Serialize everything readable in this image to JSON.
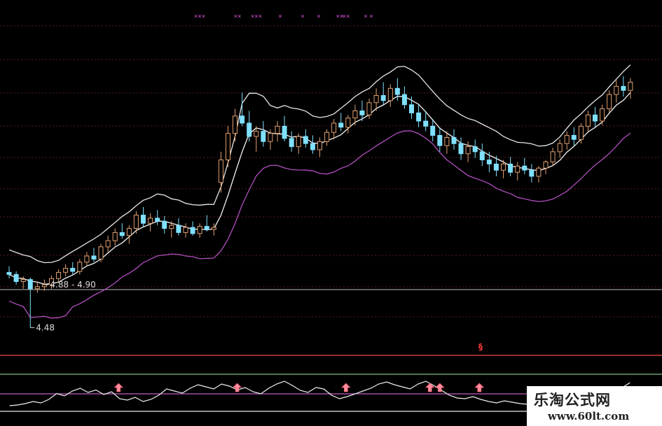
{
  "chart_data": [
    {
      "type": "candlestick",
      "title": "",
      "price_labels": [
        {
          "text": "4.88 - 4.90",
          "index": 5
        },
        {
          "text": "4.48",
          "index": 3
        }
      ],
      "top_markers": [
        "×××",
        "××",
        "×××",
        "×",
        "×",
        "×",
        "××",
        "×",
        "××",
        "×"
      ],
      "candles": [
        [
          5.02,
          5.08,
          4.96,
          5.0
        ],
        [
          5.0,
          5.03,
          4.9,
          4.93
        ],
        [
          4.93,
          4.98,
          4.86,
          4.95
        ],
        [
          4.95,
          4.97,
          4.48,
          4.86
        ],
        [
          4.86,
          4.92,
          4.82,
          4.88
        ],
        [
          4.88,
          4.95,
          4.84,
          4.9
        ],
        [
          4.9,
          4.99,
          4.86,
          4.96
        ],
        [
          4.96,
          5.05,
          4.92,
          5.02
        ],
        [
          5.02,
          5.1,
          4.98,
          5.06
        ],
        [
          5.06,
          5.12,
          5.0,
          5.03
        ],
        [
          5.03,
          5.15,
          5.0,
          5.12
        ],
        [
          5.12,
          5.22,
          5.08,
          5.18
        ],
        [
          5.18,
          5.26,
          5.12,
          5.15
        ],
        [
          5.15,
          5.3,
          5.12,
          5.27
        ],
        [
          5.27,
          5.38,
          5.22,
          5.33
        ],
        [
          5.33,
          5.45,
          5.28,
          5.41
        ],
        [
          5.41,
          5.5,
          5.35,
          5.38
        ],
        [
          5.38,
          5.48,
          5.3,
          5.45
        ],
        [
          5.45,
          5.62,
          5.4,
          5.58
        ],
        [
          5.58,
          5.66,
          5.46,
          5.5
        ],
        [
          5.5,
          5.6,
          5.42,
          5.55
        ],
        [
          5.55,
          5.63,
          5.48,
          5.52
        ],
        [
          5.52,
          5.57,
          5.4,
          5.45
        ],
        [
          5.45,
          5.52,
          5.36,
          5.48
        ],
        [
          5.48,
          5.55,
          5.38,
          5.41
        ],
        [
          5.41,
          5.5,
          5.36,
          5.46
        ],
        [
          5.46,
          5.52,
          5.38,
          5.4
        ],
        [
          5.4,
          5.5,
          5.36,
          5.47
        ],
        [
          5.47,
          5.58,
          5.42,
          5.44
        ],
        [
          5.44,
          5.5,
          5.38,
          5.46
        ],
        [
          5.9,
          6.2,
          5.8,
          6.12
        ],
        [
          6.12,
          6.45,
          6.05,
          6.38
        ],
        [
          6.38,
          6.62,
          6.3,
          6.55
        ],
        [
          6.55,
          6.78,
          6.45,
          6.48
        ],
        [
          6.48,
          6.6,
          6.3,
          6.35
        ],
        [
          6.35,
          6.45,
          6.2,
          6.4
        ],
        [
          6.4,
          6.5,
          6.25,
          6.3
        ],
        [
          6.3,
          6.42,
          6.22,
          6.38
        ],
        [
          6.38,
          6.5,
          6.3,
          6.45
        ],
        [
          6.45,
          6.55,
          6.3,
          6.33
        ],
        [
          6.33,
          6.4,
          6.2,
          6.25
        ],
        [
          6.25,
          6.38,
          6.18,
          6.35
        ],
        [
          6.35,
          6.42,
          6.24,
          6.28
        ],
        [
          6.28,
          6.36,
          6.18,
          6.22
        ],
        [
          6.22,
          6.34,
          6.15,
          6.3
        ],
        [
          6.3,
          6.42,
          6.26,
          6.39
        ],
        [
          6.39,
          6.52,
          6.32,
          6.48
        ],
        [
          6.48,
          6.58,
          6.4,
          6.44
        ],
        [
          6.44,
          6.56,
          6.38,
          6.53
        ],
        [
          6.53,
          6.66,
          6.46,
          6.6
        ],
        [
          6.6,
          6.7,
          6.5,
          6.56
        ],
        [
          6.56,
          6.72,
          6.52,
          6.68
        ],
        [
          6.68,
          6.82,
          6.6,
          6.75
        ],
        [
          6.75,
          6.88,
          6.66,
          6.7
        ],
        [
          6.7,
          6.86,
          6.64,
          6.82
        ],
        [
          6.82,
          6.92,
          6.7,
          6.76
        ],
        [
          6.76,
          6.84,
          6.62,
          6.66
        ],
        [
          6.66,
          6.74,
          6.52,
          6.58
        ],
        [
          6.58,
          6.66,
          6.44,
          6.5
        ],
        [
          6.5,
          6.6,
          6.4,
          6.45
        ],
        [
          6.45,
          6.52,
          6.3,
          6.36
        ],
        [
          6.36,
          6.44,
          6.2,
          6.26
        ],
        [
          6.26,
          6.4,
          6.18,
          6.34
        ],
        [
          6.34,
          6.42,
          6.22,
          6.28
        ],
        [
          6.28,
          6.34,
          6.12,
          6.18
        ],
        [
          6.18,
          6.3,
          6.1,
          6.25
        ],
        [
          6.25,
          6.32,
          6.14,
          6.2
        ],
        [
          6.2,
          6.28,
          6.06,
          6.12
        ],
        [
          6.12,
          6.2,
          6.0,
          6.08
        ],
        [
          6.08,
          6.16,
          5.96,
          6.02
        ],
        [
          6.02,
          6.12,
          5.94,
          6.08
        ],
        [
          6.08,
          6.15,
          5.96,
          6.0
        ],
        [
          6.0,
          6.1,
          5.92,
          6.06
        ],
        [
          6.06,
          6.14,
          5.98,
          6.02
        ],
        [
          6.02,
          6.08,
          5.9,
          5.96
        ],
        [
          5.96,
          6.06,
          5.9,
          6.04
        ],
        [
          6.04,
          6.12,
          5.98,
          6.1
        ],
        [
          6.1,
          6.24,
          6.06,
          6.2
        ],
        [
          6.2,
          6.32,
          6.14,
          6.28
        ],
        [
          6.28,
          6.4,
          6.22,
          6.36
        ],
        [
          6.36,
          6.44,
          6.26,
          6.32
        ],
        [
          6.32,
          6.48,
          6.28,
          6.45
        ],
        [
          6.45,
          6.6,
          6.4,
          6.56
        ],
        [
          6.56,
          6.64,
          6.44,
          6.5
        ],
        [
          6.5,
          6.66,
          6.46,
          6.62
        ],
        [
          6.62,
          6.8,
          6.58,
          6.76
        ],
        [
          6.76,
          6.9,
          6.68,
          6.84
        ],
        [
          6.84,
          6.94,
          6.74,
          6.8
        ],
        [
          6.8,
          6.92,
          6.72,
          6.88
        ]
      ]
    },
    {
      "type": "line",
      "title": "",
      "alert_mark": "§",
      "series": [
        {
          "values": [
            10,
            12,
            16,
            22,
            18,
            28,
            45,
            38,
            52,
            60,
            48,
            55,
            42,
            50,
            30,
            26,
            34,
            22,
            28,
            40,
            58,
            52,
            46,
            60,
            70,
            64,
            58,
            72,
            66,
            55,
            62,
            50,
            44,
            60,
            72,
            80,
            68,
            54,
            48,
            62,
            58,
            40,
            30,
            36,
            44,
            52,
            60,
            72,
            78,
            70,
            64,
            58,
            72,
            80,
            68,
            54,
            40,
            32,
            30,
            36,
            28,
            22,
            18,
            24,
            20,
            16,
            14,
            18,
            26,
            34,
            42,
            30,
            24,
            36,
            48,
            20,
            18,
            40,
            62,
            76
          ]
        }
      ],
      "arrow_indices": [
        15,
        39,
        61,
        78,
        80,
        101,
        126
      ]
    }
  ]
}
